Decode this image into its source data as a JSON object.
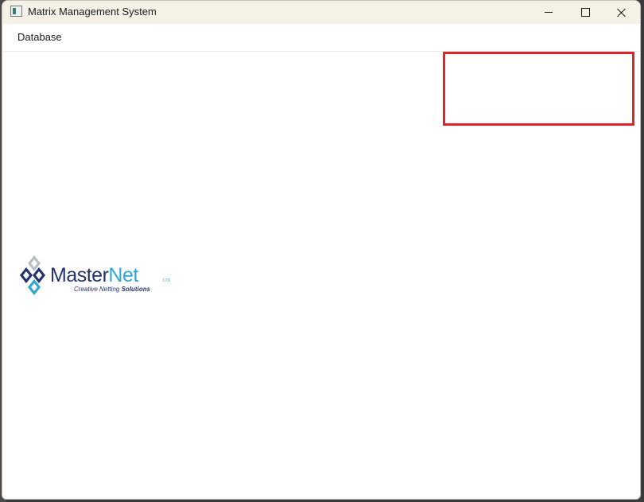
{
  "window": {
    "title": "Matrix Management System",
    "icon": "app-window-icon",
    "controls": {
      "minimize_icon": "minimize-icon",
      "maximize_icon": "maximize-icon",
      "close_icon": "close-icon"
    }
  },
  "menubar": {
    "items": [
      {
        "label": "Database"
      }
    ]
  },
  "logo": {
    "name_part1": "Master",
    "name_part2": "Net",
    "suffix": "LTD",
    "tagline_part1": "Creative Netting ",
    "tagline_part2": "Solutions",
    "colors": {
      "navy": "#24326c",
      "cyan": "#2ea7d8",
      "grey": "#b8bec6"
    }
  },
  "annotation": {
    "color": "#e0242c"
  }
}
